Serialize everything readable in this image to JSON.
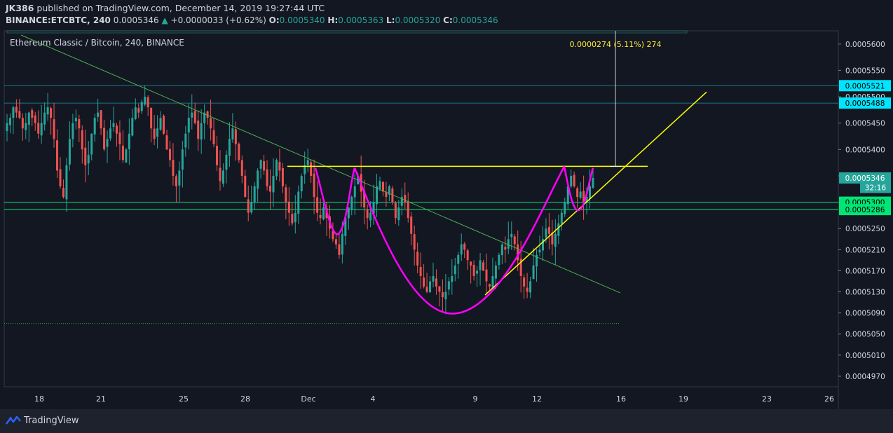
{
  "header": {
    "author": "JK386",
    "published": "published on TradingView.com, December 14, 2019 19:27:44 UTC",
    "symbol": "BINANCE:ETCBTC, 240",
    "last": "0.0005346",
    "change": "+0.0000033 (+0.62%)",
    "o_label": "O:",
    "o": "0.0005340",
    "h_label": "H:",
    "h": "0.0005363",
    "l_label": "L:",
    "l": "0.0005320",
    "c_label": "C:",
    "c": "0.0005346"
  },
  "footer": {
    "brand": "TradingView"
  },
  "colors": {
    "up": "#26a69a",
    "down": "#ef5350",
    "bg": "#131722",
    "pattern": "#ff00ff",
    "trend": "#ffff00",
    "downtrend": "#4caf50"
  },
  "chart_data": {
    "type": "candlestick",
    "title": "Ethereum Classic / Bitcoin, 240, BINANCE",
    "ylim": [
      0.000495,
      0.0005625
    ],
    "y_ticks": [
      "0.0005600",
      "0.0005550",
      "0.0005500",
      "0.0005450",
      "0.0005400",
      "0.0005350",
      "0.0005300",
      "0.0005250",
      "0.0005210",
      "0.0005170",
      "0.0005130",
      "0.0005090",
      "0.0005050",
      "0.0005010",
      "0.0004970"
    ],
    "x_ticks": [
      "18",
      "21",
      "25",
      "28",
      "Dec",
      "4",
      "9",
      "12",
      "16",
      "19",
      "23",
      "26"
    ],
    "price_labels": [
      {
        "text": "0.0005521",
        "color": "#00e5ff",
        "value": 0.0005521
      },
      {
        "text": "0.0005488",
        "color": "#00e5ff",
        "value": 0.0005488
      },
      {
        "text": "0.0005346",
        "color": "#26a69a",
        "value": 0.0005346
      },
      {
        "text": "32:16",
        "color": "#26a69a",
        "value": 0.0005328
      },
      {
        "text": "0.0005300",
        "color": "#00e676",
        "value": 0.00053
      },
      {
        "text": "0.0005286",
        "color": "#00e676",
        "value": 0.0005286
      }
    ],
    "measure_label": "0.0000274 (5.11%) 274",
    "candles_close": [
      0.000545,
      0.000546,
      0.000548,
      0.000547,
      0.000546,
      0.000544,
      0.000545,
      0.000547,
      0.000546,
      0.000545,
      0.000543,
      0.000545,
      0.000547,
      0.000548,
      0.000546,
      0.000542,
      0.000536,
      0.000533,
      0.000531,
      0.000537,
      0.000542,
      0.000545,
      0.000546,
      0.000544,
      0.00054,
      0.000537,
      0.000539,
      0.000543,
      0.000546,
      0.000547,
      0.000544,
      0.00054,
      0.000542,
      0.000544,
      0.000545,
      0.000543,
      0.000541,
      0.000538,
      0.00054,
      0.000543,
      0.000546,
      0.000548,
      0.000547,
      0.000549,
      0.00055,
      0.000548,
      0.000544,
      0.000542,
      0.000544,
      0.000546,
      0.000543,
      0.00054,
      0.000538,
      0.000535,
      0.000533,
      0.000536,
      0.00054,
      0.000543,
      0.000546,
      0.000547,
      0.000545,
      0.000542,
      0.000545,
      0.000547,
      0.000546,
      0.000544,
      0.000541,
      0.000537,
      0.000534,
      0.000536,
      0.000539,
      0.000542,
      0.000544,
      0.000541,
      0.000538,
      0.000535,
      0.000531,
      0.000528,
      0.00053,
      0.000533,
      0.000536,
      0.000538,
      0.000536,
      0.000533,
      0.000532,
      0.000535,
      0.000538,
      0.000536,
      0.000533,
      0.00053,
      0.000528,
      0.000526,
      0.000528,
      0.000532,
      0.000535,
      0.000537,
      0.000538,
      0.000535,
      0.000531,
      0.000528,
      0.000527,
      0.000529,
      0.000527,
      0.000525,
      0.000523,
      0.000522,
      0.00052,
      0.000524,
      0.000527,
      0.000529,
      0.000531,
      0.000533,
      0.000535,
      0.000532,
      0.000529,
      0.000527,
      0.000528,
      0.00053,
      0.000533,
      0.000534,
      0.000532,
      0.000531,
      0.000533,
      0.00053,
      0.000527,
      0.000529,
      0.000531,
      0.00053,
      0.000527,
      0.000524,
      0.000521,
      0.000518,
      0.000516,
      0.000514,
      0.000513,
      0.000515,
      0.000516,
      0.000514,
      0.000513,
      0.000512,
      0.000513,
      0.000515,
      0.000516,
      0.000518,
      0.00052,
      0.000522,
      0.000521,
      0.000519,
      0.000518,
      0.000516,
      0.000517,
      0.000519,
      0.000517,
      0.000515,
      0.000514,
      0.000516,
      0.000518,
      0.00052,
      0.000522,
      0.000521,
      0.000523,
      0.000524,
      0.000522,
      0.000519,
      0.000516,
      0.000514,
      0.000513,
      0.000515,
      0.000518,
      0.00052,
      0.000521,
      0.000523,
      0.000525,
      0.000524,
      0.000522,
      0.000524,
      0.000526,
      0.000528,
      0.00053,
      0.000533,
      0.000535,
      0.000533,
      0.000531,
      0.000532,
      0.00053,
      0.000531,
      0.000533,
      0.0005346
    ]
  }
}
